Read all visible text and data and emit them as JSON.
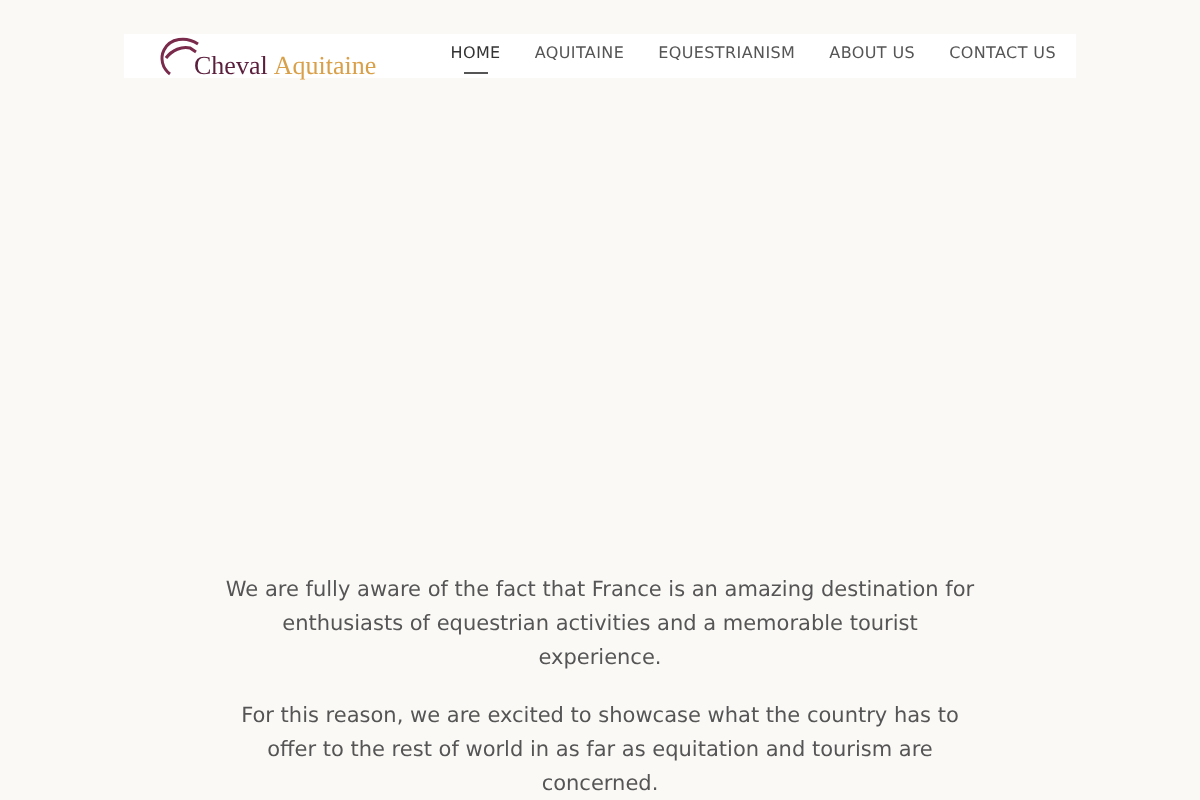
{
  "logo": {
    "word_1": "Cheval",
    "word_2": "Aquitaine"
  },
  "nav": [
    {
      "label": "HOME",
      "selected": true
    },
    {
      "label": "AQUITAINE",
      "selected": false
    },
    {
      "label": "EQUESTRIANISM",
      "selected": false
    },
    {
      "label": "ABOUT US",
      "selected": false
    },
    {
      "label": "CONTACT US",
      "selected": false
    }
  ],
  "paragraphs": [
    "We are fully aware of the fact that France is an amazing destination for enthusiasts of equestrian activities and a memorable tourist experience.",
    "For this reason, we are excited to showcase what the country has to offer to the rest of world in as far as equitation and tourism are concerned."
  ]
}
